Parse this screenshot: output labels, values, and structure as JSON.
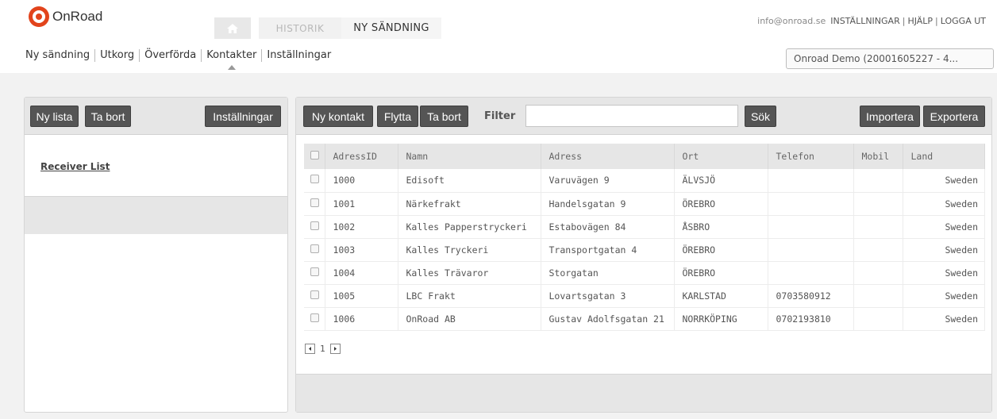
{
  "brand": {
    "name": "OnRoad"
  },
  "tabs": {
    "historik": "HISTORIK",
    "ny_sandning": "NY SÄNDNING"
  },
  "top_links": {
    "email": "info@onroad.se",
    "settings": "INSTÄLLNINGAR",
    "help": "HJÄLP",
    "logout": "LOGGA UT"
  },
  "subnav": [
    "Ny sändning",
    "Utkorg",
    "Överförda",
    "Kontakter",
    "Inställningar"
  ],
  "account_select": {
    "value": "Onroad Demo (20001605227 - 4..."
  },
  "left_toolbar": {
    "new_list": "Ny lista",
    "delete": "Ta bort",
    "settings": "Inställningar"
  },
  "left_list": {
    "item": "Receiver List"
  },
  "right_toolbar": {
    "new_contact": "Ny kontakt",
    "move": "Flytta",
    "delete": "Ta bort",
    "filter_label": "Filter",
    "search": "Sök",
    "import": "Importera",
    "export": "Exportera"
  },
  "table": {
    "headers": [
      "AdressID",
      "Namn",
      "Adress",
      "Ort",
      "Telefon",
      "Mobil",
      "Land"
    ],
    "rows": [
      [
        "1000",
        "Edisoft",
        "Varuvägen 9",
        "ÄLVSJÖ",
        "",
        "",
        "Sweden"
      ],
      [
        "1001",
        "Närkefrakt",
        "Handelsgatan 9",
        "ÖREBRO",
        "",
        "",
        "Sweden"
      ],
      [
        "1002",
        "Kalles Papperstryckeri",
        "Estabovägen 84",
        "ÅSBRO",
        "",
        "",
        "Sweden"
      ],
      [
        "1003",
        "Kalles Tryckeri",
        "Transportgatan 4",
        "ÖREBRO",
        "",
        "",
        "Sweden"
      ],
      [
        "1004",
        "Kalles Trävaror",
        "Storgatan",
        "ÖREBRO",
        "",
        "",
        "Sweden"
      ],
      [
        "1005",
        "LBC Frakt",
        "Lovartsgatan 3",
        "KARLSTAD",
        "0703580912",
        "",
        "Sweden"
      ],
      [
        "1006",
        "OnRoad AB",
        "Gustav Adolfsgatan 21",
        "NORRKÖPING",
        "0702193810",
        "",
        "Sweden"
      ]
    ]
  },
  "pager": {
    "page": "1"
  }
}
